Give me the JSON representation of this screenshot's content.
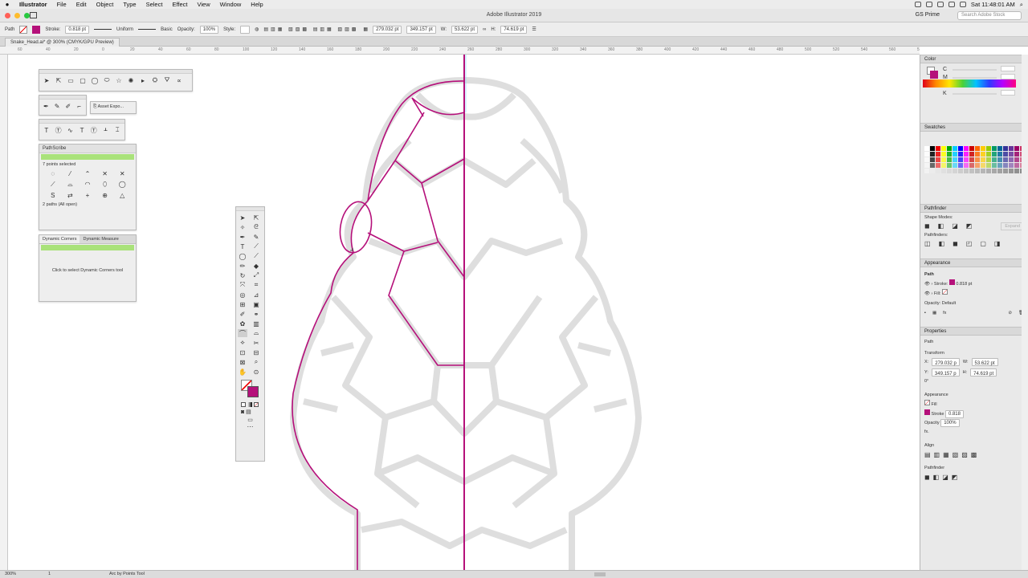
{
  "menu": {
    "app": "Illustrator",
    "items": [
      "File",
      "Edit",
      "Object",
      "Type",
      "Select",
      "Effect",
      "View",
      "Window",
      "Help"
    ],
    "clock": "Sat 11:48:01 AM"
  },
  "window": {
    "title": "Adobe Illustrator 2019",
    "workspace": "GS Prime",
    "search_placeholder": "Search Adobe Stock"
  },
  "control": {
    "label": "Path",
    "stroke_label": "Stroke:",
    "stroke_value": "0.818 pt",
    "profile": "Uniform",
    "brush": "Basic",
    "opacity_label": "Opacity:",
    "opacity": "100%",
    "style_label": "Style:",
    "x": "279.032 pt",
    "y": "349.157 pt",
    "w_label": "W:",
    "w": "53.622 pt",
    "h_label": "H:",
    "h": "74.619 pt"
  },
  "document": {
    "tab": "Snake_Head.ai* @ 300% (CMYK/GPU Preview)"
  },
  "ruler": {
    "numbers": [
      "60",
      "40",
      "20",
      "0",
      "20",
      "40",
      "60",
      "80",
      "100",
      "120",
      "140",
      "160",
      "180",
      "200",
      "220",
      "240",
      "260",
      "280",
      "300",
      "320",
      "340",
      "360",
      "380",
      "400",
      "420",
      "440",
      "460",
      "480",
      "500",
      "520",
      "540",
      "560",
      "580"
    ]
  },
  "floating": {
    "asset_export": "Asset Expo...",
    "pathscribe": {
      "title": "PathScribe",
      "selected": "7 points selected",
      "paths": "2 paths (All open)"
    },
    "dc": {
      "tab1": "Dynamic Corners",
      "tab2": "Dynamic Measure",
      "hint": "Click to select Dynamic Corners tool"
    }
  },
  "right": {
    "color": "Color",
    "color_labels": [
      "C",
      "M",
      "Y",
      "K"
    ],
    "swatches": "Swatches",
    "pathfinder": "Pathfinder",
    "shape_modes": "Shape Modes:",
    "pathfinders": "Pathfinders:",
    "expand": "Expand",
    "appearance": {
      "title": "Appearance",
      "path": "Path",
      "stroke_label": "Stroke:",
      "stroke_value": "0.818 pt",
      "fill_label": "Fill:",
      "opacity_label": "Opacity:",
      "opacity_value": "Default",
      "fx": "fx"
    },
    "properties": {
      "title": "Properties",
      "kind": "Path",
      "transform": "Transform",
      "x_label": "X:",
      "x": "279.032 p",
      "y_label": "Y:",
      "y": "349.157 p",
      "w_label": "W:",
      "w": "53.622 pt",
      "h_label": "H:",
      "h": "74.619 pt",
      "angle": "0°",
      "appearance": "Appearance",
      "fill": "Fill",
      "stroke": "Stroke",
      "stroke_value": "0.818",
      "opacity": "Opacity",
      "opacity_value": "100%",
      "fx": "fx.",
      "align": "Align",
      "pathfinder": "Pathfinder"
    }
  },
  "status": {
    "zoom": "300%",
    "page": "1",
    "tool": "Arc by Points Tool"
  },
  "colors": {
    "accent": "#b5107a",
    "green": "#a9e27a"
  }
}
